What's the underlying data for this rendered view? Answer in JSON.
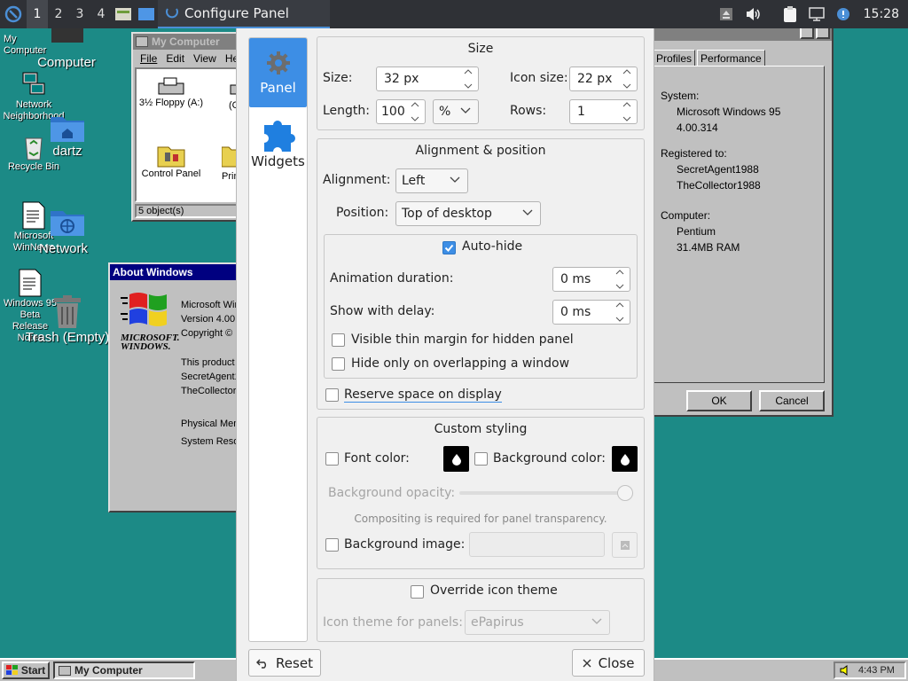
{
  "top_panel": {
    "workspaces": [
      "1",
      "2",
      "3",
      "4"
    ],
    "active_workspace": "1",
    "active_task_title": "Configure Panel",
    "clock": "15:28",
    "accent": "#4b8fd6"
  },
  "desktop_icons": [
    {
      "id": "my-computer",
      "label": "My Computer"
    },
    {
      "id": "computer",
      "label": "Computer"
    },
    {
      "id": "network-neighborhood",
      "label": "Network Neighborhood"
    },
    {
      "id": "dartz",
      "label": "dartz"
    },
    {
      "id": "recycle-bin",
      "label": "Recycle Bin"
    },
    {
      "id": "microsoft-winnews",
      "label": "Microsoft WinNews"
    },
    {
      "id": "network",
      "label": "Network"
    },
    {
      "id": "beta-release-notes",
      "label": "Windows 95 Beta Release Notes"
    },
    {
      "id": "trash",
      "label": "Trash (Empty)"
    }
  ],
  "my_computer_window": {
    "title": "My Computer",
    "menu": [
      "File",
      "Edit",
      "View",
      "He"
    ],
    "items": [
      {
        "label": "3½ Floppy (A:)"
      },
      {
        "label": "(C"
      },
      {
        "label": "Control Panel"
      },
      {
        "label": "Prin"
      }
    ],
    "status": "5 object(s)"
  },
  "about_window": {
    "title": "About Windows",
    "logo_line1": "MICROSOFT.",
    "logo_line2": "WINDOWS.",
    "lines": [
      "Microsoft Wir",
      "Version 4.00.",
      "Copyright © 1"
    ],
    "licensed_lines": [
      "This product",
      "SecretAgent1",
      "TheCollector1"
    ],
    "memory_lines": [
      "Physical Mem",
      "System Reso"
    ]
  },
  "system_props_window": {
    "tabs": [
      "Profiles",
      "Performance"
    ],
    "system_label": "System:",
    "system_values": [
      "Microsoft Windows 95",
      "4.00.314"
    ],
    "registered_label": "Registered to:",
    "registered_values": [
      "SecretAgent1988",
      "TheCollector1988"
    ],
    "computer_label": "Computer:",
    "computer_values": [
      "Pentium",
      "31.4MB RAM"
    ],
    "ok_label": "OK",
    "cancel_label": "Cancel"
  },
  "win95_taskbar": {
    "start_label": "Start",
    "task_label": "My Computer",
    "time": "4:43 PM"
  },
  "config": {
    "sidebar": [
      {
        "label": "Panel",
        "active": true
      },
      {
        "label": "Widgets",
        "active": false
      }
    ],
    "size_group": {
      "title": "Size",
      "size_label": "Size:",
      "size_value": "32 px",
      "icon_size_label": "Icon size:",
      "icon_size_value": "22 px",
      "length_label": "Length:",
      "length_value": "100",
      "length_unit": "%",
      "rows_label": "Rows:",
      "rows_value": "1"
    },
    "align_group": {
      "title": "Alignment & position",
      "alignment_label": "Alignment:",
      "alignment_value": "Left",
      "position_label": "Position:",
      "position_value": "Top of desktop",
      "autohide_label": "Auto-hide",
      "autohide_checked": true,
      "anim_label": "Animation duration:",
      "anim_value": "0 ms",
      "delay_label": "Show with delay:",
      "delay_value": "0 ms",
      "thin_margin_label": "Visible thin margin for hidden panel",
      "overlap_label": "Hide only on overlapping a window",
      "reserve_label": "Reserve space on display"
    },
    "style_group": {
      "title": "Custom styling",
      "font_color_label": "Font color:",
      "bg_color_label": "Background color:",
      "opacity_label": "Background opacity:",
      "opacity_level": 1.0,
      "compositing_note": "Compositing is required for panel transparency.",
      "bg_image_label": "Background image:"
    },
    "icon_group": {
      "override_label": "Override icon theme",
      "theme_label": "Icon theme for panels:",
      "theme_value": "ePapirus"
    },
    "reset_label": "Reset",
    "close_label": "Close",
    "accent": "#3d8ee5"
  }
}
